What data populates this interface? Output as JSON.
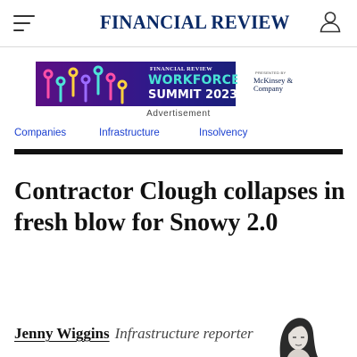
{
  "header": {
    "menu_icon": "hamburger-menu-icon",
    "logo_text": "FINANCIAL REVIEW",
    "account_icon": "user-account-icon",
    "colors": {
      "logo": "#0a2a66",
      "border": "#d9d9d9"
    }
  },
  "ad": {
    "brand": "FINANCIAL REVIEW",
    "line1": "WORKFORCE",
    "line2": "SUMMIT 2023",
    "presented_by": "PRESENTED BY",
    "sponsor": "McKinsey & Company",
    "label": "Advertisement",
    "colors": {
      "bg_left": "#5a0f84",
      "bg_mid": "#1a1f7a",
      "accent": "#49e3d6"
    }
  },
  "topics": [
    {
      "label": "Companies"
    },
    {
      "label": "Infrastructure"
    },
    {
      "label": "Insolvency"
    }
  ],
  "topic_link_color": "#1a3fd0",
  "article": {
    "headline": "Contractor Clough collapses in fresh blow for Snowy 2.0",
    "author": "Jenny Wiggins",
    "role": "Infrastructure reporter"
  }
}
